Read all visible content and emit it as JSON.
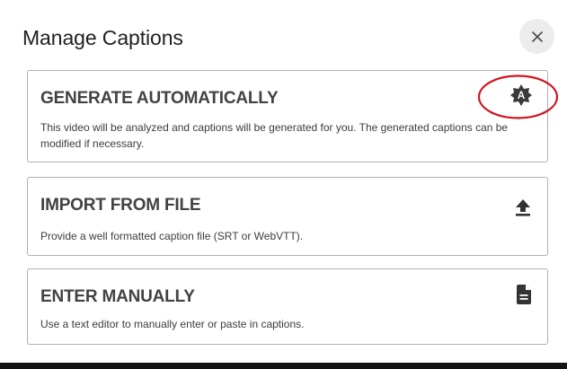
{
  "dialog": {
    "title": "Manage Captions",
    "close_icon": "close-icon"
  },
  "options": [
    {
      "title": "GENERATE AUTOMATICALLY",
      "description": "This video will be analyzed and captions will be generated for you. The generated captions can be modified if necessary.",
      "icon": "auto-caption-icon",
      "highlighted": true
    },
    {
      "title": "IMPORT FROM FILE",
      "description": "Provide a well formatted caption file (SRT or WebVTT).",
      "icon": "upload-icon"
    },
    {
      "title": "ENTER MANUALLY",
      "description": "Use a text editor to manually enter or paste in captions.",
      "icon": "document-icon"
    }
  ],
  "colors": {
    "title_text": "#212121",
    "card_title": "#424242",
    "card_border": "#b0b0b0",
    "icon": "#3a3a3a",
    "highlight_ring": "#d0131f",
    "close_button_bg": "#ececec"
  }
}
